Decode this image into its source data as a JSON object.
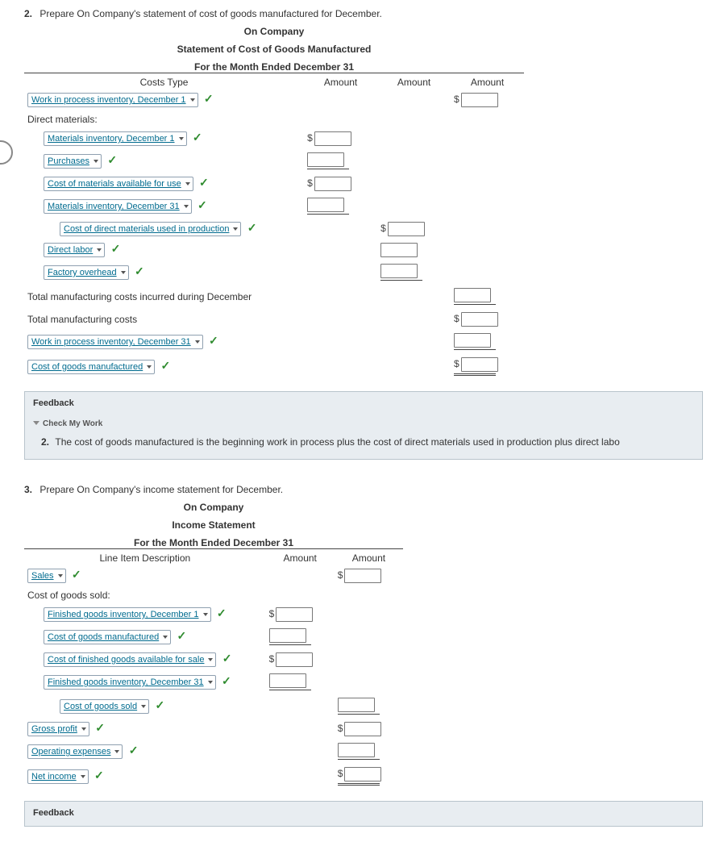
{
  "q2": {
    "number": "2.",
    "text": "Prepare On Company's statement of cost of goods manufactured for December.",
    "statement_title1": "On Company",
    "statement_title2": "Statement of Cost of Goods Manufactured",
    "statement_title3": "For the Month Ended December 31",
    "col0": "Costs Type",
    "col1": "Amount",
    "col2": "Amount",
    "col3": "Amount",
    "rows": {
      "r1": "Work in process inventory, December 1",
      "dm_header": "Direct materials:",
      "r2": "Materials inventory, December 1",
      "r3": "Purchases",
      "r4": "Cost of materials available for use",
      "r5": "Materials inventory, December 31",
      "r6": "Cost of direct materials used in production",
      "r7": "Direct labor",
      "r8": "Factory overhead",
      "r9": "Total manufacturing costs incurred during December",
      "r10": "Total manufacturing costs",
      "r11": "Work in process inventory, December 31",
      "r12": "Cost of goods manufactured"
    },
    "feedback_label": "Feedback",
    "check_label": "Check My Work",
    "feedback_num": "2.",
    "feedback_text": "The cost of goods manufactured is the beginning work in process plus the cost of direct materials used in production plus direct labo"
  },
  "q3": {
    "number": "3.",
    "text": "Prepare On Company's income statement for December.",
    "statement_title1": "On Company",
    "statement_title2": "Income Statement",
    "statement_title3": "For the Month Ended December 31",
    "col0": "Line Item Description",
    "col1": "Amount",
    "col2": "Amount",
    "rows": {
      "r1": "Sales",
      "cogs_header": "Cost of goods sold:",
      "r2": "Finished goods inventory, December 1",
      "r3": "Cost of goods manufactured",
      "r4": "Cost of finished goods available for sale",
      "r5": "Finished goods inventory, December 31",
      "r6": "Cost of goods sold",
      "r7": "Gross profit",
      "r8": "Operating expenses",
      "r9": "Net income"
    },
    "feedback_label": "Feedback"
  },
  "dollar": "$"
}
